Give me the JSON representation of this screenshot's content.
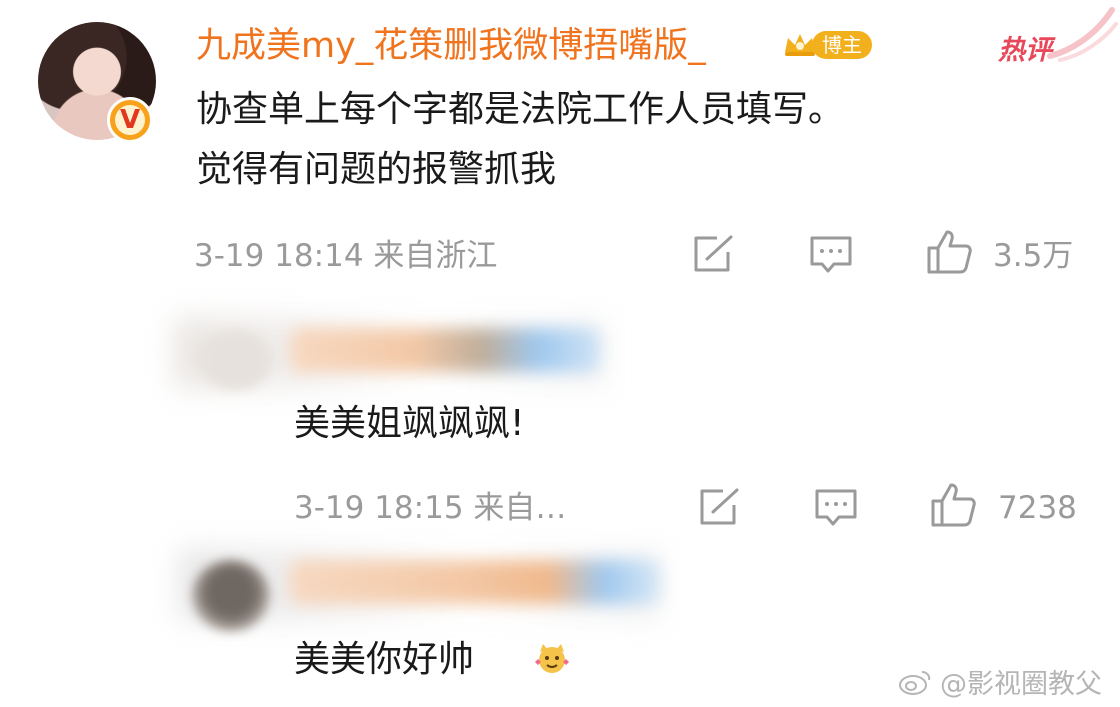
{
  "post_comment": {
    "username": "九成美my_花策删我微博捂嘴版_",
    "badge": "博主",
    "hot_label": "热评",
    "text_line1": "协查单上每个字都是法院工作人员填写。",
    "text_line2": "觉得有问题的报警抓我",
    "meta": "3-19 18:14  来自浙江",
    "like_count": "3.5万"
  },
  "reply_1": {
    "text": "美美姐飒飒飒!",
    "meta": "3-19 18:15  来自…",
    "like_count": "7238"
  },
  "reply_2": {
    "text": "美美你好帅"
  },
  "watermark": "@影视圈教父",
  "colors": {
    "username": "#f0731e",
    "badge_bg": "#f3b01d",
    "hot_label": "#e8495a",
    "meta_gray": "#9a9a9a"
  },
  "icons": [
    "verified-v-icon",
    "crown-icon",
    "share-icon",
    "comment-icon",
    "like-icon",
    "sticker-icon",
    "weibo-logo-icon"
  ]
}
